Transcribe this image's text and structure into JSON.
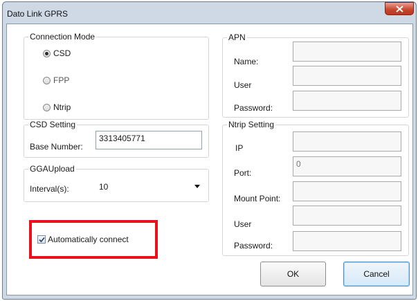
{
  "window": {
    "title": "Dato Link  GPRS"
  },
  "connection_mode": {
    "legend": "Connection Mode",
    "options": [
      {
        "label": "CSD",
        "selected": true
      },
      {
        "label": "FPP",
        "selected": false
      },
      {
        "label": "Ntrip",
        "selected": false
      }
    ]
  },
  "apn": {
    "legend": "APN",
    "name_label": "Name:",
    "user_label": "User",
    "password_label": "Password:",
    "name_value": "",
    "user_value": "",
    "password_value": ""
  },
  "csd_setting": {
    "legend": "CSD Setting",
    "base_number_label": "Base Number:",
    "base_number_value": "3313405771"
  },
  "ntrip_setting": {
    "legend": "Ntrip Setting",
    "ip_label": "IP",
    "port_label": "Port:",
    "port_value": "0",
    "mount_point_label": "Mount Point:",
    "user_label": "User",
    "password_label": "Password:"
  },
  "gga_upload": {
    "legend": "GGAUpload",
    "interval_label": "Interval(s):",
    "interval_value": "10"
  },
  "auto_connect": {
    "label": "Automatically connect",
    "checked": true
  },
  "buttons": {
    "ok": "OK",
    "cancel": "Cancel"
  },
  "colors": {
    "highlight": "#e8101a",
    "close": "#c9442c",
    "default_button": "#4f93c9"
  }
}
